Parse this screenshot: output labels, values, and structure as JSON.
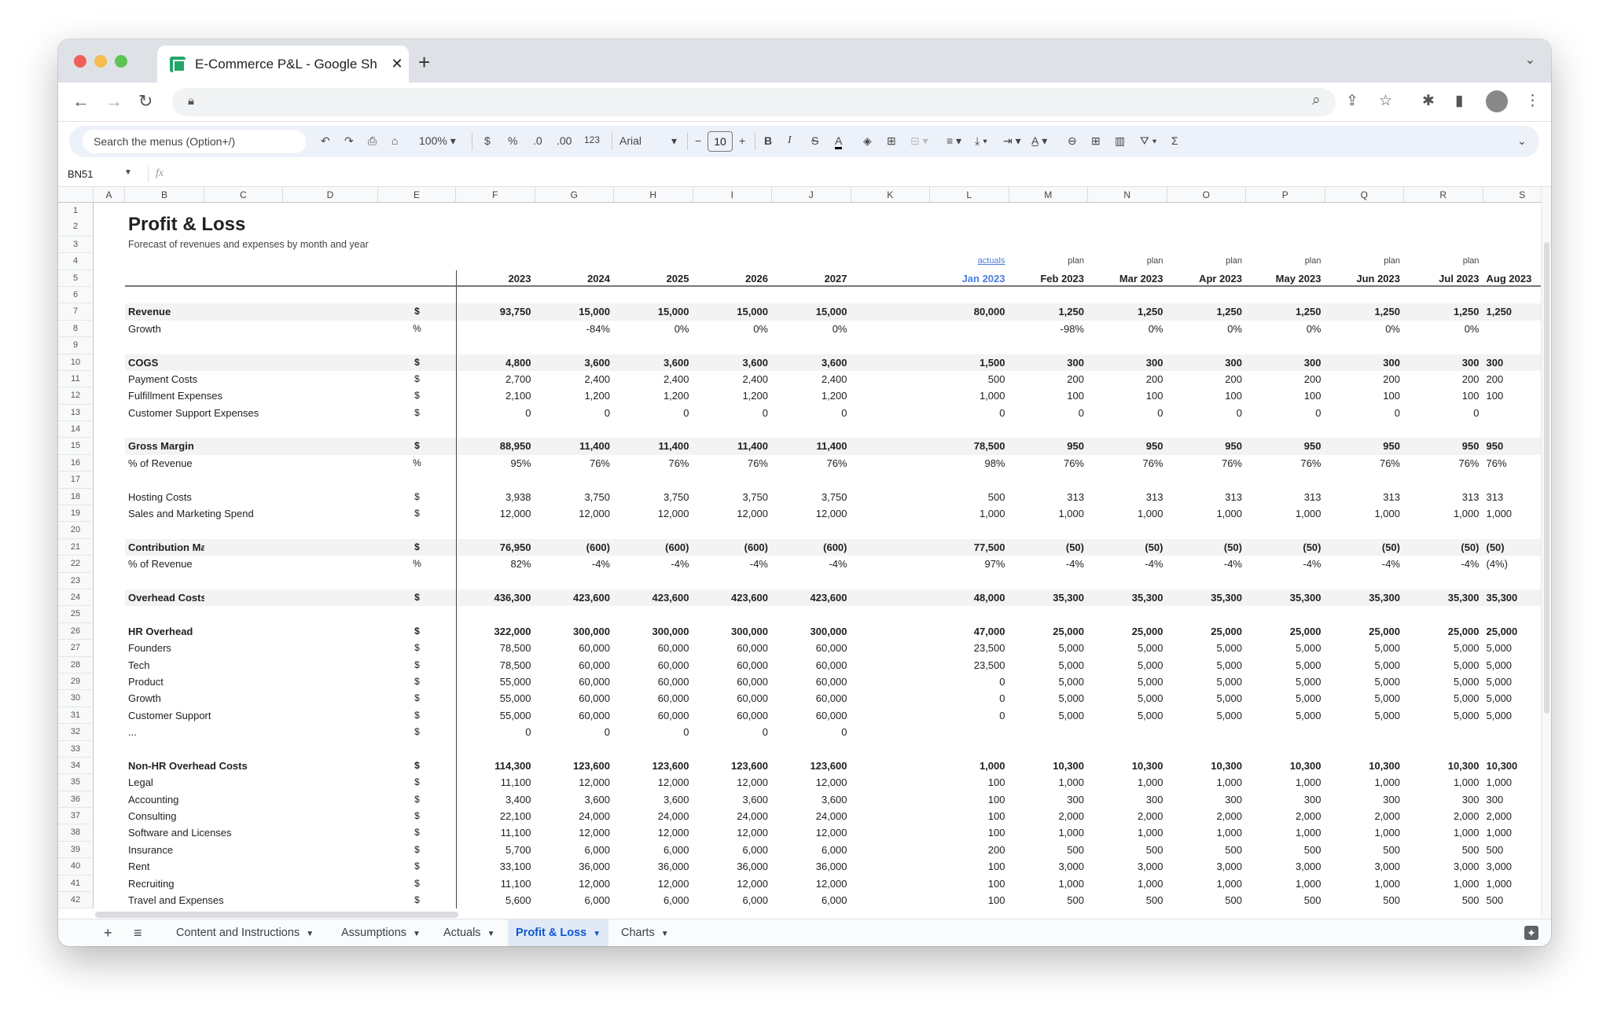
{
  "browser": {
    "tab_title": "E-Commerce P&L - Google Sheets",
    "tab_title_visible": "E-Commerce P&L - Google Sh",
    "new_tab": "+",
    "close": "✕"
  },
  "toolbar": {
    "search_placeholder": "Search the menus (Option+/)",
    "zoom": "100%",
    "currency": "$",
    "percent": "%",
    "decrease_decimal": ".0",
    "increase_decimal": ".00",
    "number_format": "123",
    "font": "Arial",
    "font_size": "10",
    "bold": "B",
    "italic": "I",
    "strike": "S",
    "text_color": "A",
    "sum": "Σ"
  },
  "formula_bar": {
    "name_box": "BN51",
    "fx": "fx",
    "value": ""
  },
  "columns": [
    "A",
    "B",
    "C",
    "D",
    "E",
    "F",
    "G",
    "H",
    "I",
    "J",
    "K",
    "L",
    "M",
    "N",
    "O",
    "P",
    "Q",
    "R",
    "S"
  ],
  "row_count": 42,
  "sheet": {
    "title": "Profit & Loss",
    "subtitle": "Forecast of revenues and expenses by month and year",
    "year_headers": [
      "2023",
      "2024",
      "2025",
      "2026",
      "2027"
    ],
    "month_status": [
      "actuals",
      "plan",
      "plan",
      "plan",
      "plan",
      "plan",
      "plan",
      ""
    ],
    "month_headers": [
      "Jan 2023",
      "Feb 2023",
      "Mar 2023",
      "Apr 2023",
      "May 2023",
      "Jun 2023",
      "Jul 2023",
      "Aug 2023"
    ],
    "accent_color": "#4a7fe0",
    "rows": [
      {
        "row": 7,
        "label": "Revenue",
        "unit": "$",
        "bold": true,
        "shaded": true,
        "years": [
          "93,750",
          "15,000",
          "15,000",
          "15,000",
          "15,000"
        ],
        "months": [
          "80,000",
          "1,250",
          "1,250",
          "1,250",
          "1,250",
          "1,250",
          "1,250",
          "1,250"
        ]
      },
      {
        "row": 8,
        "label": "Growth",
        "unit": "%",
        "years": [
          "",
          "-84%",
          "0%",
          "0%",
          "0%"
        ],
        "months": [
          "",
          "-98%",
          "0%",
          "0%",
          "0%",
          "0%",
          "0%",
          ""
        ]
      },
      {
        "row": 10,
        "label": "COGS",
        "unit": "$",
        "bold": true,
        "shaded": true,
        "years": [
          "4,800",
          "3,600",
          "3,600",
          "3,600",
          "3,600"
        ],
        "months": [
          "1,500",
          "300",
          "300",
          "300",
          "300",
          "300",
          "300",
          "300"
        ]
      },
      {
        "row": 11,
        "label": "Payment Costs",
        "unit": "$",
        "years": [
          "2,700",
          "2,400",
          "2,400",
          "2,400",
          "2,400"
        ],
        "months": [
          "500",
          "200",
          "200",
          "200",
          "200",
          "200",
          "200",
          "200"
        ]
      },
      {
        "row": 12,
        "label": "Fulfillment Expenses",
        "unit": "$",
        "years": [
          "2,100",
          "1,200",
          "1,200",
          "1,200",
          "1,200"
        ],
        "months": [
          "1,000",
          "100",
          "100",
          "100",
          "100",
          "100",
          "100",
          "100"
        ]
      },
      {
        "row": 13,
        "label": "Customer Support Expenses",
        "unit": "$",
        "years": [
          "0",
          "0",
          "0",
          "0",
          "0"
        ],
        "months": [
          "0",
          "0",
          "0",
          "0",
          "0",
          "0",
          "0",
          ""
        ]
      },
      {
        "row": 15,
        "label": "Gross Margin",
        "unit": "$",
        "bold": true,
        "shaded": true,
        "years": [
          "88,950",
          "11,400",
          "11,400",
          "11,400",
          "11,400"
        ],
        "months": [
          "78,500",
          "950",
          "950",
          "950",
          "950",
          "950",
          "950",
          "950"
        ]
      },
      {
        "row": 16,
        "label": "% of Revenue",
        "unit": "%",
        "years": [
          "95%",
          "76%",
          "76%",
          "76%",
          "76%"
        ],
        "months": [
          "98%",
          "76%",
          "76%",
          "76%",
          "76%",
          "76%",
          "76%",
          "76%"
        ]
      },
      {
        "row": 18,
        "label": "Hosting Costs",
        "unit": "$",
        "years": [
          "3,938",
          "3,750",
          "3,750",
          "3,750",
          "3,750"
        ],
        "months": [
          "500",
          "313",
          "313",
          "313",
          "313",
          "313",
          "313",
          "313"
        ]
      },
      {
        "row": 19,
        "label": "Sales and Marketing Spend",
        "unit": "$",
        "years": [
          "12,000",
          "12,000",
          "12,000",
          "12,000",
          "12,000"
        ],
        "months": [
          "1,000",
          "1,000",
          "1,000",
          "1,000",
          "1,000",
          "1,000",
          "1,000",
          "1,000"
        ]
      },
      {
        "row": 21,
        "label": "Contribution Margin",
        "unit": "$",
        "bold": true,
        "shaded": true,
        "years": [
          "76,950",
          "(600)",
          "(600)",
          "(600)",
          "(600)"
        ],
        "months": [
          "77,500",
          "(50)",
          "(50)",
          "(50)",
          "(50)",
          "(50)",
          "(50)",
          "(50)"
        ]
      },
      {
        "row": 22,
        "label": "% of Revenue",
        "unit": "%",
        "years": [
          "82%",
          "-4%",
          "-4%",
          "-4%",
          "-4%"
        ],
        "months": [
          "97%",
          "-4%",
          "-4%",
          "-4%",
          "-4%",
          "-4%",
          "-4%",
          "(4%)"
        ]
      },
      {
        "row": 24,
        "label": "Overhead Costs",
        "unit": "$",
        "bold": true,
        "shaded": true,
        "years": [
          "436,300",
          "423,600",
          "423,600",
          "423,600",
          "423,600"
        ],
        "months": [
          "48,000",
          "35,300",
          "35,300",
          "35,300",
          "35,300",
          "35,300",
          "35,300",
          "35,300"
        ]
      },
      {
        "row": 26,
        "label": "HR Overhead",
        "unit": "$",
        "bold": true,
        "years": [
          "322,000",
          "300,000",
          "300,000",
          "300,000",
          "300,000"
        ],
        "months": [
          "47,000",
          "25,000",
          "25,000",
          "25,000",
          "25,000",
          "25,000",
          "25,000",
          "25,000"
        ]
      },
      {
        "row": 27,
        "label": "Founders",
        "unit": "$",
        "years": [
          "78,500",
          "60,000",
          "60,000",
          "60,000",
          "60,000"
        ],
        "months": [
          "23,500",
          "5,000",
          "5,000",
          "5,000",
          "5,000",
          "5,000",
          "5,000",
          "5,000"
        ]
      },
      {
        "row": 28,
        "label": "Tech",
        "unit": "$",
        "years": [
          "78,500",
          "60,000",
          "60,000",
          "60,000",
          "60,000"
        ],
        "months": [
          "23,500",
          "5,000",
          "5,000",
          "5,000",
          "5,000",
          "5,000",
          "5,000",
          "5,000"
        ]
      },
      {
        "row": 29,
        "label": "Product",
        "unit": "$",
        "years": [
          "55,000",
          "60,000",
          "60,000",
          "60,000",
          "60,000"
        ],
        "months": [
          "0",
          "5,000",
          "5,000",
          "5,000",
          "5,000",
          "5,000",
          "5,000",
          "5,000"
        ]
      },
      {
        "row": 30,
        "label": "Growth",
        "unit": "$",
        "years": [
          "55,000",
          "60,000",
          "60,000",
          "60,000",
          "60,000"
        ],
        "months": [
          "0",
          "5,000",
          "5,000",
          "5,000",
          "5,000",
          "5,000",
          "5,000",
          "5,000"
        ]
      },
      {
        "row": 31,
        "label": "Customer Support",
        "unit": "$",
        "years": [
          "55,000",
          "60,000",
          "60,000",
          "60,000",
          "60,000"
        ],
        "months": [
          "0",
          "5,000",
          "5,000",
          "5,000",
          "5,000",
          "5,000",
          "5,000",
          "5,000"
        ]
      },
      {
        "row": 32,
        "label": "...",
        "unit": "$",
        "years": [
          "0",
          "0",
          "0",
          "0",
          "0"
        ],
        "months": [
          "",
          "",
          "",
          "",
          "",
          "",
          "",
          ""
        ]
      },
      {
        "row": 34,
        "label": "Non-HR Overhead Costs",
        "unit": "$",
        "bold": true,
        "years": [
          "114,300",
          "123,600",
          "123,600",
          "123,600",
          "123,600"
        ],
        "months": [
          "1,000",
          "10,300",
          "10,300",
          "10,300",
          "10,300",
          "10,300",
          "10,300",
          "10,300"
        ]
      },
      {
        "row": 35,
        "label": "Legal",
        "unit": "$",
        "years": [
          "11,100",
          "12,000",
          "12,000",
          "12,000",
          "12,000"
        ],
        "months": [
          "100",
          "1,000",
          "1,000",
          "1,000",
          "1,000",
          "1,000",
          "1,000",
          "1,000"
        ]
      },
      {
        "row": 36,
        "label": "Accounting",
        "unit": "$",
        "years": [
          "3,400",
          "3,600",
          "3,600",
          "3,600",
          "3,600"
        ],
        "months": [
          "100",
          "300",
          "300",
          "300",
          "300",
          "300",
          "300",
          "300"
        ]
      },
      {
        "row": 37,
        "label": "Consulting",
        "unit": "$",
        "years": [
          "22,100",
          "24,000",
          "24,000",
          "24,000",
          "24,000"
        ],
        "months": [
          "100",
          "2,000",
          "2,000",
          "2,000",
          "2,000",
          "2,000",
          "2,000",
          "2,000"
        ]
      },
      {
        "row": 38,
        "label": "Software and Licenses",
        "unit": "$",
        "years": [
          "11,100",
          "12,000",
          "12,000",
          "12,000",
          "12,000"
        ],
        "months": [
          "100",
          "1,000",
          "1,000",
          "1,000",
          "1,000",
          "1,000",
          "1,000",
          "1,000"
        ]
      },
      {
        "row": 39,
        "label": "Insurance",
        "unit": "$",
        "years": [
          "5,700",
          "6,000",
          "6,000",
          "6,000",
          "6,000"
        ],
        "months": [
          "200",
          "500",
          "500",
          "500",
          "500",
          "500",
          "500",
          "500"
        ]
      },
      {
        "row": 40,
        "label": "Rent",
        "unit": "$",
        "years": [
          "33,100",
          "36,000",
          "36,000",
          "36,000",
          "36,000"
        ],
        "months": [
          "100",
          "3,000",
          "3,000",
          "3,000",
          "3,000",
          "3,000",
          "3,000",
          "3,000"
        ]
      },
      {
        "row": 41,
        "label": "Recruiting",
        "unit": "$",
        "years": [
          "11,100",
          "12,000",
          "12,000",
          "12,000",
          "12,000"
        ],
        "months": [
          "100",
          "1,000",
          "1,000",
          "1,000",
          "1,000",
          "1,000",
          "1,000",
          "1,000"
        ]
      },
      {
        "row": 42,
        "label": "Travel and Expenses",
        "unit": "$",
        "years": [
          "5,600",
          "6,000",
          "6,000",
          "6,000",
          "6,000"
        ],
        "months": [
          "100",
          "500",
          "500",
          "500",
          "500",
          "500",
          "500",
          "500"
        ]
      }
    ]
  },
  "sheet_tabs": [
    {
      "label": "Content and Instructions",
      "active": false
    },
    {
      "label": "Assumptions",
      "active": false
    },
    {
      "label": "Actuals",
      "active": false
    },
    {
      "label": "Profit & Loss",
      "active": true
    },
    {
      "label": "Charts",
      "active": false
    }
  ]
}
